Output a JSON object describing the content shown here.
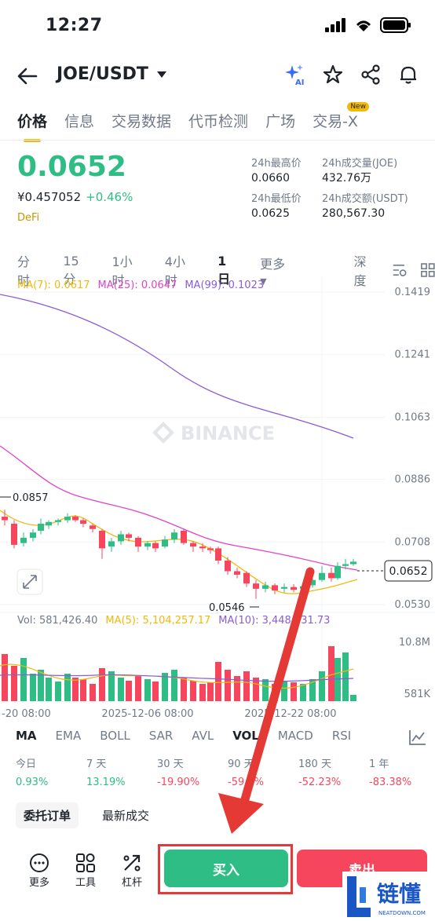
{
  "status": {
    "time": "12:27"
  },
  "header": {
    "pair": "JOE/USDT"
  },
  "tabs": [
    {
      "label": "价格",
      "active": true
    },
    {
      "label": "信息"
    },
    {
      "label": "交易数据"
    },
    {
      "label": "代币检测"
    },
    {
      "label": "广场"
    },
    {
      "label": "交易-X",
      "badge": "New"
    }
  ],
  "price": {
    "last": "0.0652",
    "cny": "¥0.457052",
    "change": "+0.46%",
    "tag": "DeFi"
  },
  "stats": {
    "high_label": "24h最高价",
    "high": "0.0660",
    "vol_joe_label": "24h成交量(JOE)",
    "vol_joe": "432.76万",
    "low_label": "24h最低价",
    "low": "0.0625",
    "vol_usdt_label": "24h成交额(USDT)",
    "vol_usdt": "280,567.30"
  },
  "intervals": [
    "分时",
    "15分",
    "1小时",
    "4小时",
    "1日"
  ],
  "interval_more": "更多",
  "interval_depth": "深度",
  "ma_legend": {
    "ma7": "MA(7): 0.0617",
    "ma25": "MA(25): 0.0647",
    "ma99": "MA(99): 0.1023"
  },
  "price_axis": [
    "0.1419",
    "0.1241",
    "0.1063",
    "0.0886",
    "0.0708",
    "0.0530"
  ],
  "current_price_tag": "0.0652",
  "annotations": {
    "high": "0.0857",
    "low": "0.0546"
  },
  "watermark": "BINANCE",
  "vol_legend": {
    "vol": "Vol: 581,426.40",
    "ma5": "MA(5): 5,104,257.17",
    "ma10": "MA(10): 3,448,131.73"
  },
  "vol_axis": [
    "10.8M",
    "581K"
  ],
  "time_axis": [
    "-20 08:00",
    "2025-12-06 08:00",
    "2025-12-22 08:00"
  ],
  "indicators": [
    "MA",
    "EMA",
    "BOLL",
    "SAR",
    "AVL",
    "VOL",
    "MACD",
    "RSI"
  ],
  "performance": [
    {
      "label": "今日",
      "value": "0.93%"
    },
    {
      "label": "7 天",
      "value": "13.19%"
    },
    {
      "label": "30 天",
      "value": "-19.90%"
    },
    {
      "label": "90 天",
      "value": "-59.8%"
    },
    {
      "label": "180 天",
      "value": "-52.23%"
    },
    {
      "label": "1 年",
      "value": "-83.38%"
    }
  ],
  "order_tabs": [
    "委托订单",
    "最新成交"
  ],
  "bottom": {
    "more": "更多",
    "tools": "工具",
    "leverage": "杠杆",
    "buy": "买入",
    "sell": "卖出"
  },
  "colors": {
    "up": "#2ebd85",
    "down": "#f6465d",
    "ma7": "#f0b90b",
    "ma25": "#e043c8",
    "ma99": "#8a5cd6",
    "accent": "#f0b90b"
  }
}
